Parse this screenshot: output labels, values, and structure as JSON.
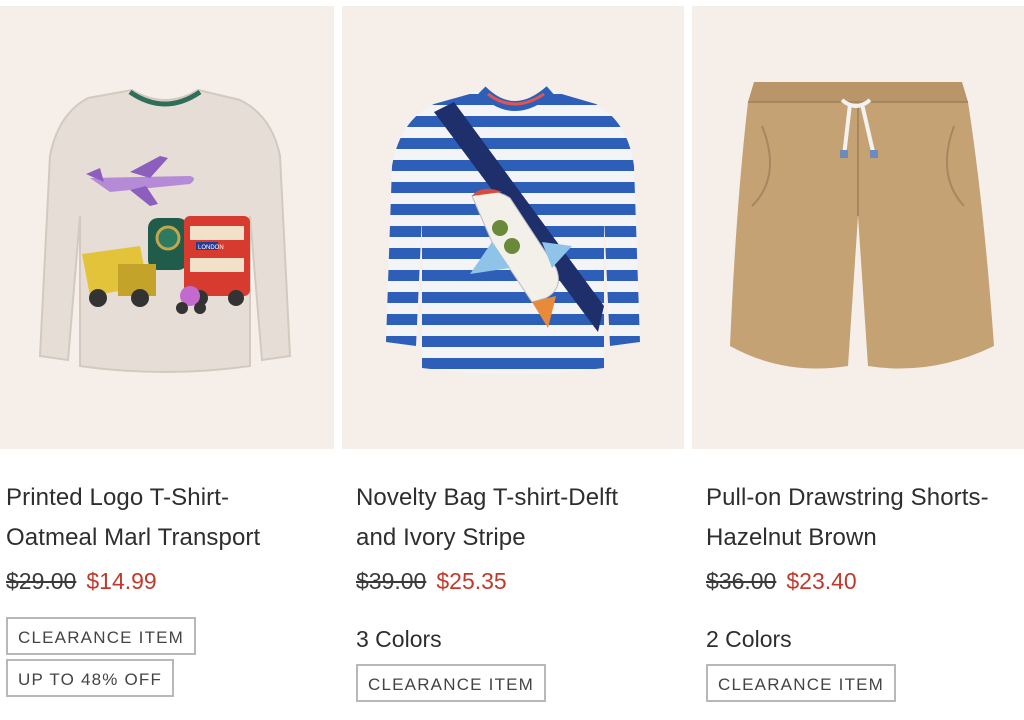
{
  "products": [
    {
      "name_line1": "Printed Logo T-Shirt-",
      "name_line2": "Oatmeal Marl Transport",
      "was_price": "$29.00",
      "now_price": "$14.99",
      "colors": "",
      "badges": [
        "CLEARANCE ITEM",
        "UP TO 48% OFF"
      ],
      "bus_sign": "LONDON"
    },
    {
      "name_line1": "Novelty Bag T-shirt-Delft",
      "name_line2": "and Ivory Stripe",
      "was_price": "$39.00",
      "now_price": "$25.35",
      "colors": "3 Colors",
      "badges": [
        "CLEARANCE ITEM"
      ]
    },
    {
      "name_line1": "Pull-on Drawstring Shorts-",
      "name_line2": "Hazelnut Brown",
      "was_price": "$36.00",
      "now_price": "$23.40",
      "colors": "2 Colors",
      "badges": [
        "CLEARANCE ITEM"
      ]
    }
  ],
  "colors": {
    "image_bg": "#f5eee9",
    "sale_price": "#c0392b",
    "badge_border": "#b8b8b8"
  }
}
